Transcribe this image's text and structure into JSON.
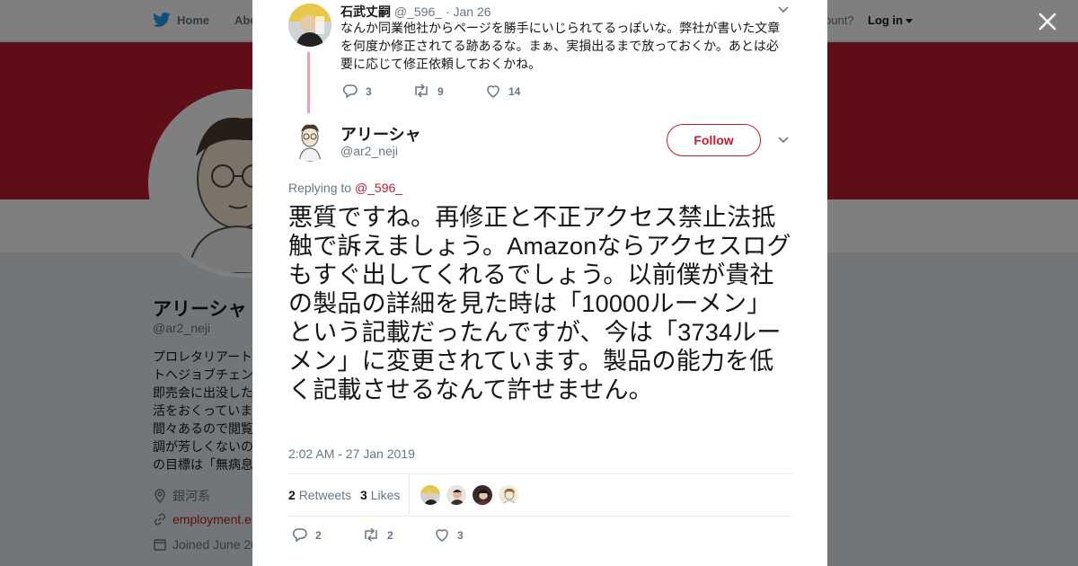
{
  "nav": {
    "home": "Home",
    "about": "Abo",
    "account_prompt": "ccount?",
    "login": "Log in"
  },
  "profile": {
    "name": "アリーシャ",
    "handle": "@ar2_neji",
    "bio_lines": [
      "プロレタリアート",
      "トへジョブチェン",
      "即売会に出没した",
      "活をおくっていま",
      "間々あるので閲覧",
      "調が芳しくないの",
      "の目標は「無病息"
    ],
    "location": "銀河系",
    "website": "employment.e",
    "joined": "Joined June 20"
  },
  "modal": {
    "previous_tweet": {
      "name": "石武丈嗣",
      "handle": "@_596_",
      "dot": "·",
      "date": "Jan 26",
      "text": "なんか同業他社からページを勝手にいじられてるっぽいな。弊社が書いた文章を何度か修正されてる跡あるな。まぁ、実損出るまで放っておくか。あとは必要に応じて修正依頼しておくかね。",
      "replies": "3",
      "retweets": "9",
      "likes": "14"
    },
    "main_tweet": {
      "name": "アリーシャ",
      "handle": "@ar2_neji",
      "follow_label": "Follow",
      "replying_prefix": "Replying to",
      "replying_to": "@_596_",
      "text": "悪質ですね。再修正と不正アクセス禁止法抵触で訴えましょう。Amazonならアクセスログもすぐ出してくれるでしょう。以前僕が貴社の製品の詳細を見た時は「10000ルーメン」という記載だったんですが、今は「3734ルーメン」に変更されています。製品の能力を低く記載させるなんて許せません。",
      "timestamp": "2:02 AM - 27 Jan 2019",
      "retweet_count": "2",
      "retweet_label": "Retweets",
      "like_count": "3",
      "like_label": "Likes",
      "replies": "2",
      "retweets": "2",
      "likes": "3"
    }
  },
  "colors": {
    "accent": "#bf1d30",
    "thread_line": "#e8a0ac",
    "muted": "#657786"
  }
}
